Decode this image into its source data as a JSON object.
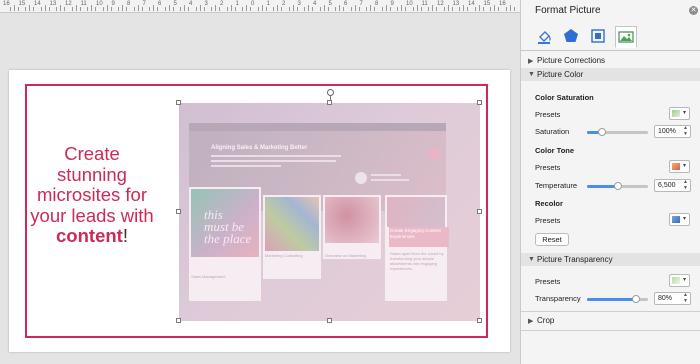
{
  "ruler": {
    "labels": [
      "16",
      "15",
      "14",
      "13",
      "12",
      "11",
      "10",
      "9",
      "8",
      "7",
      "6",
      "5",
      "4",
      "3",
      "2",
      "1",
      "0",
      "1",
      "2",
      "3",
      "4",
      "5",
      "6",
      "7",
      "8",
      "9",
      "10",
      "11",
      "12",
      "13",
      "14",
      "15",
      "16"
    ]
  },
  "slide": {
    "headline_line1": "Create",
    "headline_line2": "stunning",
    "headline_line3": "microsites for",
    "headline_line4": "your leads with",
    "headline_bold": "content",
    "headline_end": "!",
    "accent_color": "#cc2a58"
  },
  "picture": {
    "hero_title": "Aligning Sales & Marketing Better",
    "overlay_text_line1": "this",
    "overlay_text_line2": "must be",
    "overlay_text_line3": "the place",
    "card1_caption": "Sales Management",
    "card2_caption": "Marketing Consulting",
    "card3_caption": "Overview on Marketing",
    "pink_label": "Create Engaging Content Experiences",
    "body_text": "Stand apart from the crowd by transforming your simple attachments into engaging experiences."
  },
  "pane": {
    "title": "Format Picture",
    "close_icon": "close-icon",
    "tabs": [
      {
        "name": "fill-line-tab",
        "icon": "paint-bucket-icon"
      },
      {
        "name": "effects-tab",
        "icon": "pentagon-icon"
      },
      {
        "name": "size-properties-tab",
        "icon": "size-properties-icon"
      },
      {
        "name": "picture-tab",
        "icon": "picture-icon"
      }
    ],
    "sections": {
      "corrections": "Picture Corrections",
      "color": "Picture Color",
      "transparency": "Picture Transparency",
      "crop": "Crop"
    },
    "color": {
      "saturation_heading": "Color Saturation",
      "presets_label": "Presets",
      "saturation_label": "Saturation",
      "saturation_value": "100%",
      "saturation_level": 0.25,
      "tone_heading": "Color Tone",
      "tone_presets_label": "Presets",
      "temperature_label": "Temperature",
      "temperature_value": "6,500",
      "temperature_level": 0.5,
      "recolor_heading": "Recolor",
      "recolor_presets_label": "Presets",
      "reset_label": "Reset"
    },
    "transparency": {
      "presets_label": "Presets",
      "transparency_label": "Transparency",
      "transparency_value": "80%",
      "transparency_level": 0.8
    }
  }
}
